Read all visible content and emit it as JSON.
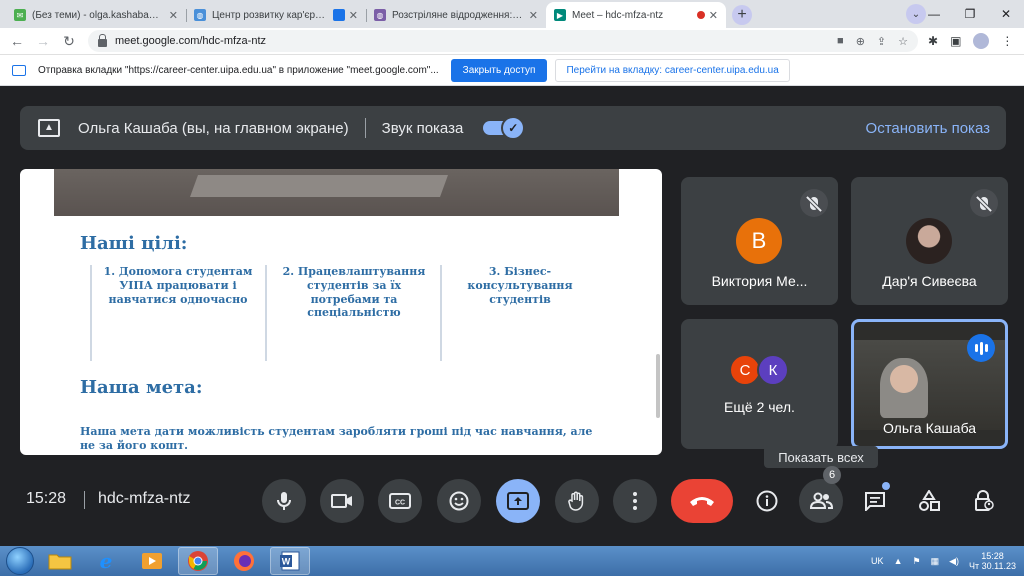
{
  "browser": {
    "tabs": [
      {
        "title": "(Без теми) - olga.kashaba@ukr.net",
        "icon": "envelope-icon",
        "color": "#4caf50"
      },
      {
        "title": "Центр розвитку кар'єри, кра",
        "icon": "globe-icon",
        "color": "#4a90d9"
      },
      {
        "title": "Розстріляне відродження: націо",
        "icon": "globe-icon",
        "color": "#7b5ea7"
      },
      {
        "title": "Meet – hdc-mfza-ntz",
        "icon": "meet-icon",
        "color": "#00897b"
      }
    ],
    "url": "meet.google.com/hdc-mfza-ntz"
  },
  "infobar": {
    "message": "Отправка вкладки \"https://career-center.uipa.edu.ua\" в приложение \"meet.google.com\"...",
    "primary_button": "Закрыть доступ",
    "secondary_button": "Перейти на вкладку: career-center.uipa.edu.ua"
  },
  "share_banner": {
    "presenter_text": "Ольга Кашаба (вы, на главном экране)",
    "audio_label": "Звук показа",
    "audio_on": true,
    "stop_label": "Остановить показ"
  },
  "slide": {
    "heading1": "Наші цілі:",
    "goals": [
      "1. Допомога студентам УІПА працювати і навчатися одночасно",
      "2. Працевлаштування студентів за їх потребами та спеціальністю",
      "3. Бізнес-консультування студентів"
    ],
    "heading2": "Наша мета:",
    "paragraph": "Наша мета дати можливість студентам заробляти гроші під час навчання, але не за його кошт."
  },
  "participants": {
    "tiles": [
      {
        "name": "Виктория Ме...",
        "initial": "В",
        "color": "#e8710a",
        "muted": true
      },
      {
        "name": "Дар'я Сивеєва",
        "muted": true
      },
      {
        "name": "Ещё 2 чел.",
        "initials": [
          "С",
          "К"
        ],
        "colors": [
          "#e8430a",
          "#5c3fbf"
        ]
      },
      {
        "name": "Ольга Кашаба",
        "speaking": true
      }
    ]
  },
  "tooltip": "Показать всех",
  "bottom_bar": {
    "time": "15:28",
    "meeting_code": "hdc-mfza-ntz",
    "participant_count": "6"
  },
  "taskbar": {
    "lang": "UK",
    "time": "15:28",
    "date": "Чт 30.11.23"
  }
}
